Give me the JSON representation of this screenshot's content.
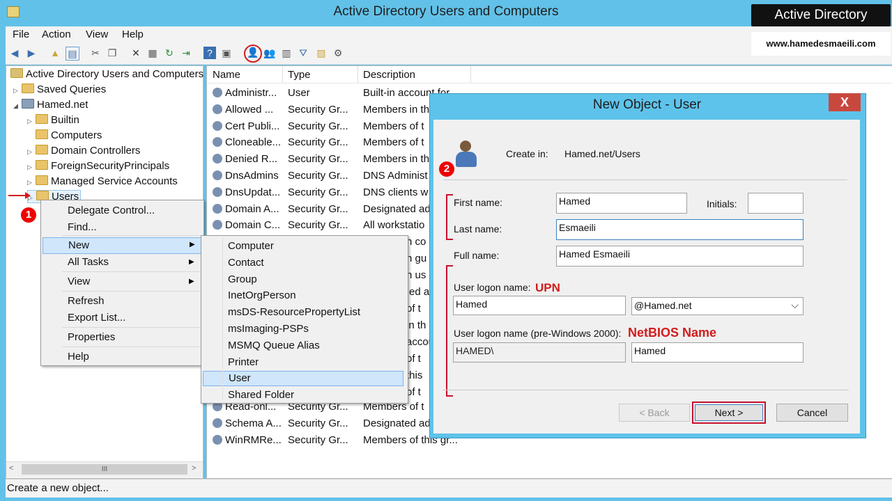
{
  "window": {
    "title": "Active Directory Users and Computers"
  },
  "menubar": [
    "File",
    "Action",
    "View",
    "Help"
  ],
  "tree": {
    "root": "Active Directory Users and Computers",
    "saved_queries": "Saved Queries",
    "domain": "Hamed.net",
    "children": [
      "Builtin",
      "Computers",
      "Domain Controllers",
      "ForeignSecurityPrincipals",
      "Managed Service Accounts",
      "Users"
    ],
    "scroll_thumb": "III"
  },
  "list": {
    "headers": [
      "Name",
      "Type",
      "Description"
    ],
    "rows": [
      [
        "Administr...",
        "User",
        "Built-in account for"
      ],
      [
        "Allowed ...",
        "Security Gr...",
        "Members in th"
      ],
      [
        "Cert Publi...",
        "Security Gr...",
        "Members of t"
      ],
      [
        "Cloneable...",
        "Security Gr...",
        "Members of t"
      ],
      [
        "Denied R...",
        "Security Gr...",
        "Members in th"
      ],
      [
        "DnsAdmins",
        "Security Gr...",
        "DNS Administ"
      ],
      [
        "DnsUpdat...",
        "Security Gr...",
        "DNS clients w"
      ],
      [
        "Domain A...",
        "Security Gr...",
        "Designated ad"
      ],
      [
        "Domain C...",
        "Security Gr...",
        "All workstatio"
      ]
    ],
    "partial_desc": [
      "n co",
      "n gu",
      "n us",
      "ed a",
      "of t",
      "in th",
      "accou",
      "of t",
      "this",
      "of t"
    ],
    "tail_rows": [
      [
        "Read-onl...",
        "Security Gr...",
        "Members of t"
      ],
      [
        "Schema A...",
        "Security Gr...",
        "Designated ad"
      ],
      [
        "WinRMRe...",
        "Security Gr...",
        "Members of this gr..."
      ]
    ]
  },
  "status": "Create a new object...",
  "context_menu": {
    "items": [
      "Delegate Control...",
      "Find...",
      "New",
      "All Tasks",
      "View",
      "Refresh",
      "Export List...",
      "Properties",
      "Help"
    ]
  },
  "submenu": {
    "items": [
      "Computer",
      "Contact",
      "Group",
      "InetOrgPerson",
      "msDS-ResourcePropertyList",
      "msImaging-PSPs",
      "MSMQ Queue Alias",
      "Printer",
      "User",
      "Shared Folder"
    ],
    "selected": "User"
  },
  "dialog": {
    "title": "New Object - User",
    "close": "X",
    "create_in_label": "Create in:",
    "create_in_value": "Hamed.net/Users",
    "first_name_label": "First name:",
    "first_name": "Hamed",
    "initials_label": "Initials:",
    "initials": "",
    "last_name_label": "Last name:",
    "last_name": "Esmaeili",
    "full_name_label": "Full name:",
    "full_name": "Hamed Esmaeili",
    "logon_label": "User logon name:",
    "logon_value": "Hamed",
    "domain_suffix": "@Hamed.net",
    "pre2000_label": "User logon name (pre-Windows 2000):",
    "pre2000_domain": "HAMED\\",
    "pre2000_value": "Hamed",
    "back": "< Back",
    "next": "Next >",
    "cancel": "Cancel"
  },
  "annotations": {
    "upn": "UPN",
    "netbios": "NetBIOS Name",
    "step1": "1",
    "step2": "2"
  },
  "watermark": {
    "title": "Active Directory",
    "site": "www.hamedesmaeili.com"
  },
  "colors": {
    "accent_red": "#d21c1c",
    "title_blue": "#62c1e8",
    "highlight": "#cfe6fb"
  }
}
